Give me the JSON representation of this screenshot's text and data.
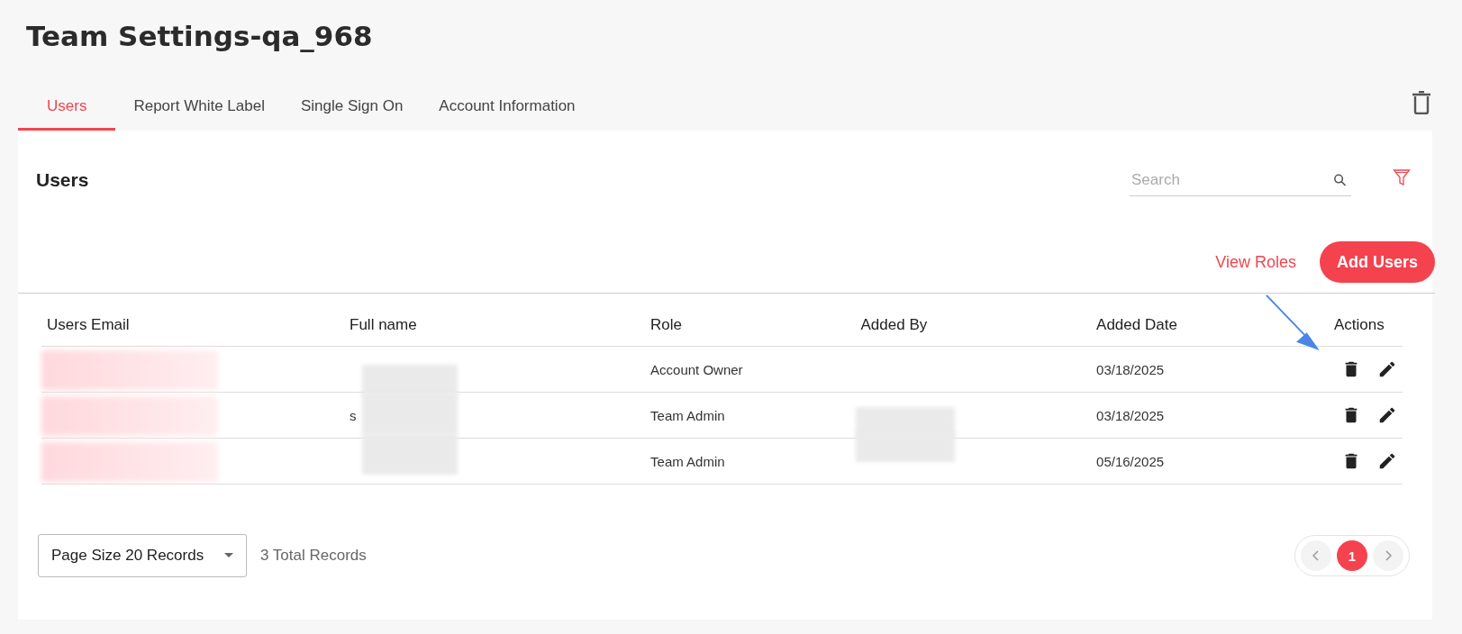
{
  "page": {
    "title": "Team Settings-qa_968"
  },
  "tabs": [
    {
      "label": "Users",
      "selected": true
    },
    {
      "label": "Report White Label",
      "selected": false
    },
    {
      "label": "Single Sign On",
      "selected": false
    },
    {
      "label": "Account Information",
      "selected": false
    }
  ],
  "panel": {
    "title": "Users",
    "search": {
      "placeholder": "Search"
    },
    "view_roles": "View Roles",
    "add_users": "Add Users"
  },
  "table": {
    "columns": [
      "Users Email",
      "Full name",
      "Role",
      "Added By",
      "Added Date",
      "Actions"
    ],
    "rows": [
      {
        "role": "Account Owner",
        "added_date": "03/18/2025"
      },
      {
        "full_name": "s",
        "role": "Team Admin",
        "added_date": "03/18/2025"
      },
      {
        "role": "Team Admin",
        "added_date": "05/16/2025"
      }
    ]
  },
  "footer": {
    "page_size": "Page Size 20 Records",
    "total": "3 Total Records",
    "pages": [
      {
        "label": "1",
        "selected": true
      }
    ]
  }
}
